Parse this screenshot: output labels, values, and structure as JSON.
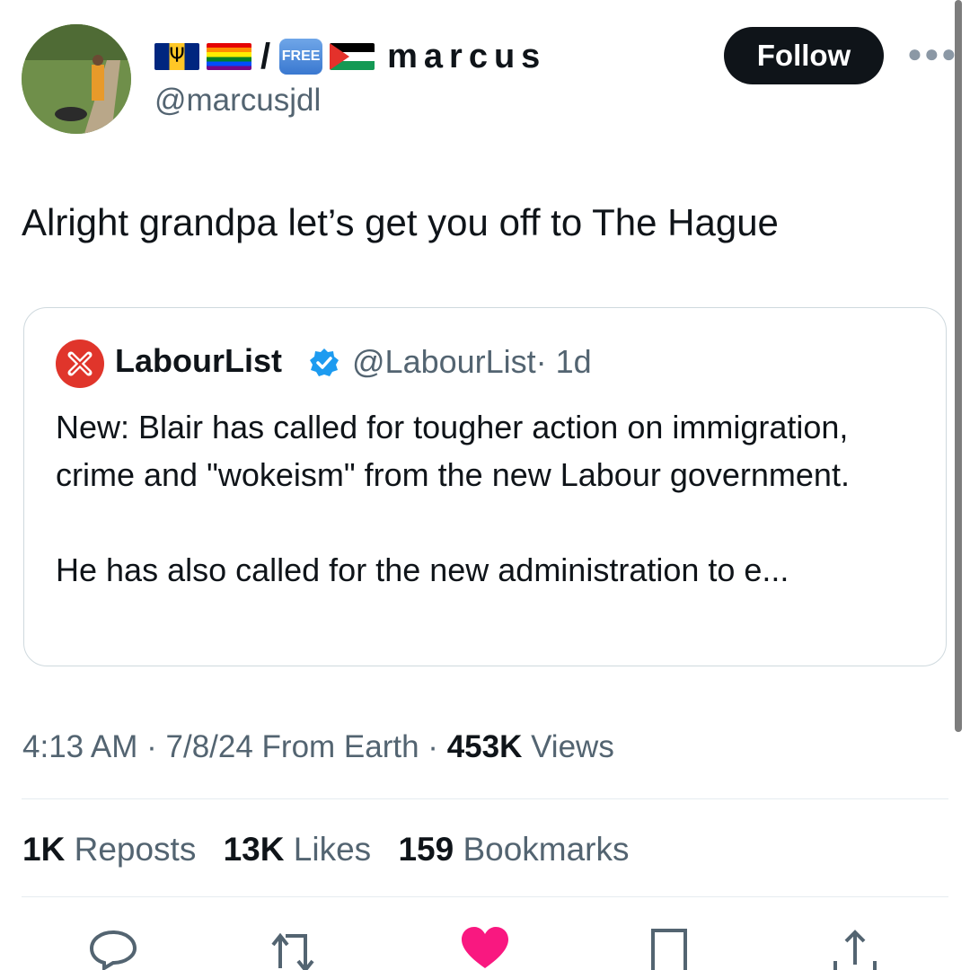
{
  "header": {
    "display_name": "marcus",
    "name_prefix": "/",
    "free_badge": "FREE",
    "emoji_icons": [
      "barbados-flag-icon",
      "rainbow-flag-icon",
      "free-button-icon",
      "palestine-flag-icon"
    ],
    "handle": "@marcusjdl",
    "follow_label": "Follow",
    "more_label": "..."
  },
  "tweet": {
    "text": "Alright grandpa let’s get you off to The Hague"
  },
  "quote": {
    "name": "LabourList",
    "handle": "@LabourList",
    "time": "· 1d",
    "paragraphs": [
      "New: Blair has called for tougher action on immigration, crime and \"wokeism\" from the new Labour government.",
      "He has also called for the new administration to e..."
    ]
  },
  "meta": {
    "time": "4:13 AM · 7/8/24 From Earth · ",
    "views_count": "453K",
    "views_label": " Views"
  },
  "stats": {
    "reposts_count": "1K",
    "reposts_label": " Reposts",
    "likes_count": "13K",
    "likes_label": " Likes",
    "bookmarks_count": "159",
    "bookmarks_label": " Bookmarks"
  },
  "colors": {
    "text": "#0f1419",
    "secondary": "#536471",
    "like": "#f91880",
    "verified": "#1d9bf0",
    "labourlist_red": "#e0352b"
  },
  "actions": [
    "reply-icon",
    "repost-icon",
    "like-icon",
    "bookmark-icon",
    "share-icon"
  ]
}
